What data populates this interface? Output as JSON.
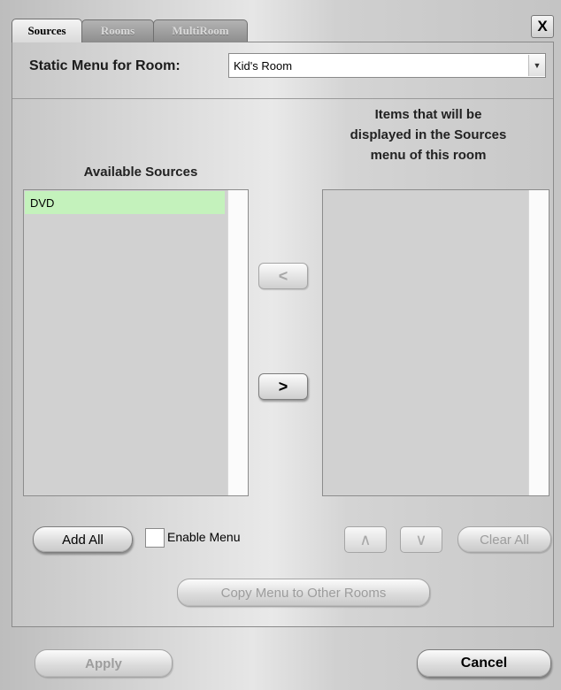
{
  "tabs": [
    {
      "label": "Sources",
      "active": true
    },
    {
      "label": "Rooms",
      "active": false
    },
    {
      "label": "MultiRoom",
      "active": false
    }
  ],
  "close_label": "X",
  "room_select": {
    "label": "Static Menu for Room:",
    "value": "Kid's Room",
    "arrow_icon": "chevron-down-icon"
  },
  "available": {
    "heading": "Available Sources",
    "items": [
      "DVD"
    ],
    "selected_color": "#c4f2bc"
  },
  "displayed": {
    "heading_lines": [
      "Items that will be",
      "displayed in the Sources",
      "menu of this room"
    ],
    "items": []
  },
  "transfer": {
    "remove_label": "<",
    "add_label": ">"
  },
  "controls": {
    "add_all": "Add All",
    "enable_menu": "Enable Menu",
    "enable_menu_checked": false,
    "move_up": "/\\",
    "move_down": "\\/",
    "clear_all": "Clear All",
    "copy_menu": "Copy Menu to Other Rooms"
  },
  "footer": {
    "apply": "Apply",
    "cancel": "Cancel"
  }
}
